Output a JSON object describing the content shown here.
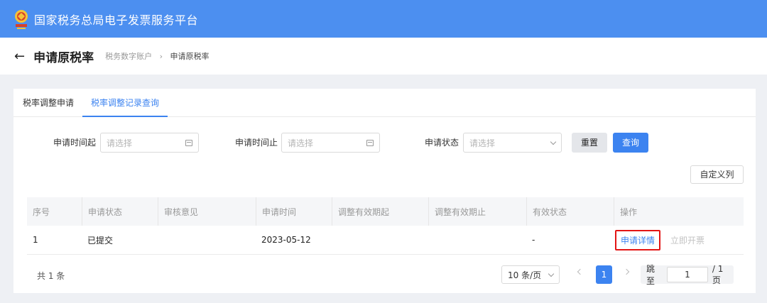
{
  "header": {
    "title": "国家税务总局电子发票服务平台"
  },
  "titlebar": {
    "back_icon": "arrow-left-icon",
    "page_title": "申请原税率",
    "breadcrumb": [
      "税务数字账户",
      "申请原税率"
    ]
  },
  "tabs": [
    {
      "label": "税率调整申请",
      "active": false
    },
    {
      "label": "税率调整记录查询",
      "active": true
    }
  ],
  "filters": {
    "start_label": "申请时间起",
    "start_placeholder": "请选择",
    "end_label": "申请时间止",
    "end_placeholder": "请选择",
    "status_label": "申请状态",
    "status_placeholder": "请选择",
    "reset_label": "重置",
    "query_label": "查询",
    "custom_columns_label": "自定义列"
  },
  "table": {
    "headers": [
      "序号",
      "申请状态",
      "审核意见",
      "申请时间",
      "调整有效期起",
      "调整有效期止",
      "有效状态",
      "操作"
    ],
    "rows": [
      {
        "index": "1",
        "status": "已提交",
        "review": "",
        "time": "2023-05-12",
        "valid_from": "",
        "valid_to": "",
        "valid_status": "-",
        "actions": [
          "申请详情",
          "立即开票"
        ]
      }
    ]
  },
  "pagination": {
    "total": "共 1 条",
    "page_size": "10 条/页",
    "current_page": "1",
    "jump_label": "跳至",
    "jump_value": "1",
    "total_pages": "/ 1 页"
  },
  "colors": {
    "primary": "#3c83f0",
    "header": "#4c8ff0",
    "highlight": "#e31515"
  }
}
